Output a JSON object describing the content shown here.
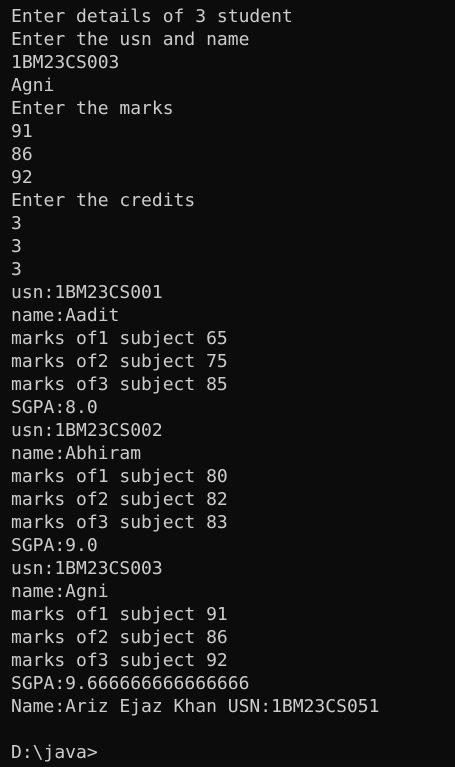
{
  "terminal": {
    "lines": [
      "Enter details of 3 student",
      "Enter the usn and name",
      "1BM23CS003",
      "Agni",
      "Enter the marks",
      "91",
      "86",
      "92",
      "Enter the credits",
      "3",
      "3",
      "3",
      "usn:1BM23CS001",
      "name:Aadit",
      "marks of1 subject 65",
      "marks of2 subject 75",
      "marks of3 subject 85",
      "SGPA:8.0",
      "usn:1BM23CS002",
      "name:Abhiram",
      "marks of1 subject 80",
      "marks of2 subject 82",
      "marks of3 subject 83",
      "SGPA:9.0",
      "usn:1BM23CS003",
      "name:Agni",
      "marks of1 subject 91",
      "marks of2 subject 86",
      "marks of3 subject 92",
      "SGPA:9.666666666666666",
      "Name:Ariz Ejaz Khan USN:1BM23CS051"
    ],
    "prompt": "D:\\java>"
  },
  "colors": {
    "background": "#0c0c0c",
    "text": "#cccccc"
  }
}
